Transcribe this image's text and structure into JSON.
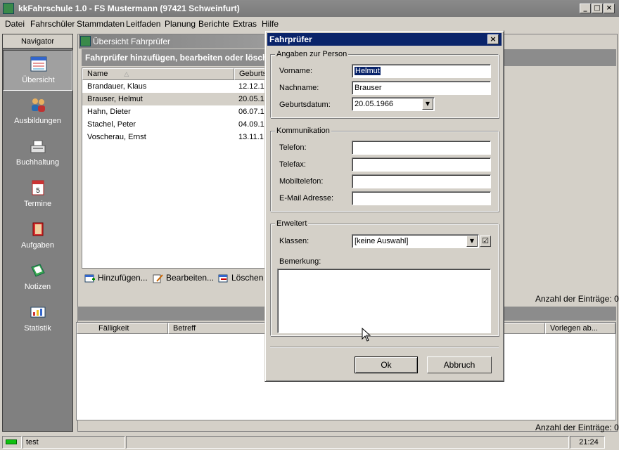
{
  "window": {
    "title": "kkFahrschule 1.0  -  FS Mustermann (97421 Schweinfurt)"
  },
  "menu": [
    "Datei",
    "Fahrschüler",
    "Stammdaten",
    "Leitfaden",
    "Planung",
    "Berichte",
    "Extras",
    "Hilfe"
  ],
  "navigator": {
    "header": "Navigator",
    "items": [
      "Übersicht",
      "Ausbildungen",
      "Buchhaltung",
      "Termine",
      "Aufgaben",
      "Notizen",
      "Statistik"
    ]
  },
  "panel": {
    "title": "Übersicht Fahrprüfer",
    "header": "Fahrprüfer hinzufügen, bearbeiten oder lösch",
    "columns": [
      "Name",
      "Geburtsd"
    ],
    "rows": [
      {
        "name": "Brandauer, Klaus",
        "date": "12.12.1"
      },
      {
        "name": "Brauser, Helmut",
        "date": "20.05.1"
      },
      {
        "name": "Hahn, Dieter",
        "date": "06.07.1"
      },
      {
        "name": "Stachel, Peter",
        "date": "04.09.1"
      },
      {
        "name": "Voscherau, Ernst",
        "date": "13.11.1"
      }
    ],
    "buttons": {
      "add": "Hinzufügen...",
      "edit": "Bearbeiten...",
      "delete": "Löschen"
    },
    "count_upper": "Anzahl der Einträge: 0",
    "lower_columns": [
      "Fälligkeit",
      "Betreff",
      "Vorlegen ab..."
    ],
    "count_lower": "Anzahl der Einträge: 0"
  },
  "dialog": {
    "title": "Fahrprüfer",
    "group_person": "Angaben zur Person",
    "label_vorname": "Vorname:",
    "value_vorname": "Helmut",
    "label_nachname": "Nachname:",
    "value_nachname": "Brauser",
    "label_geburtsdatum": "Geburtsdatum:",
    "value_geburtsdatum": "20.05.1966",
    "group_komm": "Kommunikation",
    "label_telefon": "Telefon:",
    "label_telefax": "Telefax:",
    "label_mobil": "Mobiltelefon:",
    "label_email": "E-Mail Adresse:",
    "group_erweitert": "Erweitert",
    "label_klassen": "Klassen:",
    "value_klassen": "[keine Auswahl]",
    "label_bemerkung": "Bemerkung:",
    "ok": "Ok",
    "abbruch": "Abbruch"
  },
  "statusbar": {
    "user": "test",
    "time": "21:24"
  }
}
